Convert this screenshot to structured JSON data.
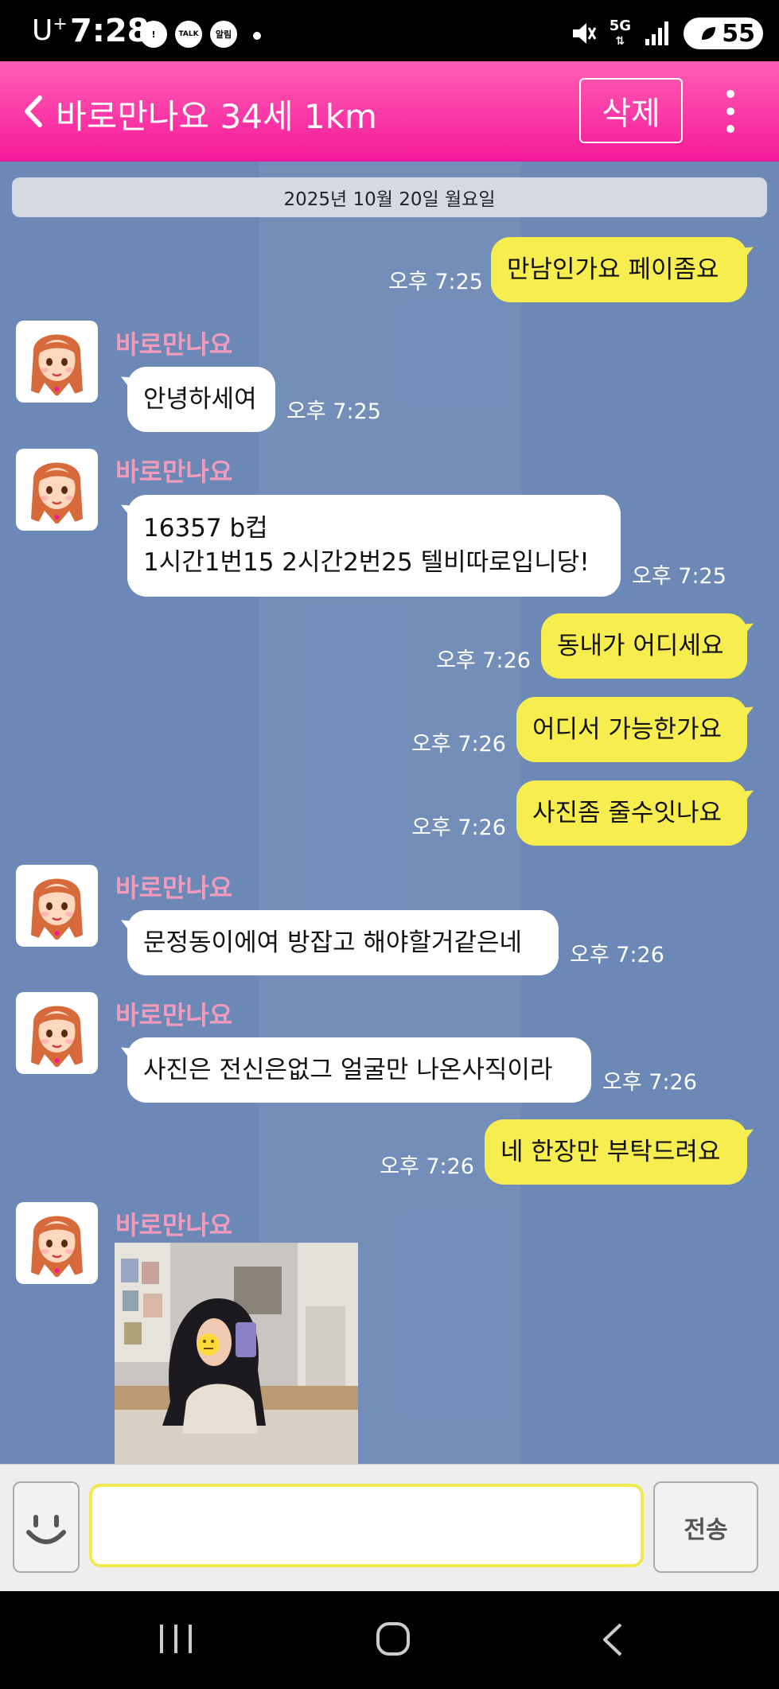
{
  "status_bar": {
    "carrier": "U",
    "carrier_sup": "+",
    "time": "7:28",
    "notification_icons": [
      "!",
      "TALK",
      "알림"
    ],
    "network": "5G",
    "battery": "55"
  },
  "header": {
    "title": "바로만나요 34세 1km",
    "delete_label": "삭제"
  },
  "chat": {
    "date_divider": "2025년 10월 20일 월요일",
    "messages": [
      {
        "from": "me",
        "text": "만남인가요 페이좀요",
        "time": "오후 7:25"
      },
      {
        "from": "them",
        "sender": "바로만나요",
        "text": "안녕하세여",
        "time": "오후 7:25"
      },
      {
        "from": "them",
        "sender": "바로만나요",
        "lines": [
          "16357 b컵",
          "1시간1번15 2시간2번25 텔비따로입니당!"
        ],
        "time": "오후 7:25"
      },
      {
        "from": "me",
        "text": "동내가 어디세요",
        "time": "오후 7:26"
      },
      {
        "from": "me",
        "text": "어디서 가능한가요",
        "time": "오후 7:26"
      },
      {
        "from": "me",
        "text": "사진좀 줄수잇나요",
        "time": "오후 7:26"
      },
      {
        "from": "them",
        "sender": "바로만나요",
        "text": "문정동이에여 방잡고 해야할거같은네",
        "time": "오후 7:26"
      },
      {
        "from": "them",
        "sender": "바로만나요",
        "text": "사진은 전신은없그 얼굴만 나온사직이라",
        "time": "오후 7:26"
      },
      {
        "from": "me",
        "text": "네 한장만 부탁드려요",
        "time": "오후 7:26"
      },
      {
        "from": "them",
        "sender": "바로만나요",
        "type": "photo"
      }
    ]
  },
  "input": {
    "placeholder": "",
    "send_label": "전송"
  },
  "colors": {
    "header": "#f5199a",
    "chat_bg": "#6b88b6",
    "outgoing_bubble": "#f8ed4e",
    "incoming_bubble": "#ffffff",
    "sender_name": "#f29bbd"
  }
}
